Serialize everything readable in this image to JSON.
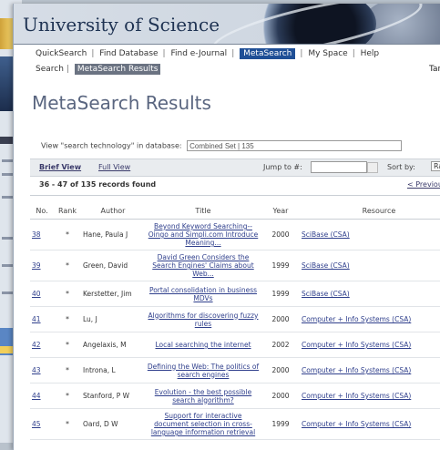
{
  "banner": {
    "title": "University of Science"
  },
  "nav": {
    "items": [
      {
        "label": "QuickSearch"
      },
      {
        "label": "Find Database"
      },
      {
        "label": "Find e-Journal"
      },
      {
        "label": "MetaSearch"
      },
      {
        "label": "My Space"
      },
      {
        "label": "Help"
      }
    ],
    "active_index": 3
  },
  "subnav": {
    "search": "Search",
    "results": "MetaSearch Results",
    "right_tab": "Tar"
  },
  "page_title": "MetaSearch Results",
  "query": {
    "prefix": "View \"search technology\" in database:",
    "database_value": "Combined Set | 135"
  },
  "view": {
    "brief": "Brief View",
    "full": "Full View",
    "jump_label": "Jump to #:",
    "jump_value": "",
    "sort_label": "Sort by:",
    "sort_value": "Ra"
  },
  "count": "36 - 47 of 135 records found",
  "prev": "< Previous",
  "columns": [
    "No.",
    "Rank",
    "Author",
    "Title",
    "Year",
    "Resource"
  ],
  "rows": [
    {
      "no": "38",
      "rank": "*",
      "author": "Hane, Paula J",
      "title": "Beyond Keyword Searching-- Oingo and Simpli.com Introduce Meaning...",
      "year": "2000",
      "resource": "SciBase (CSA)"
    },
    {
      "no": "39",
      "rank": "*",
      "author": "Green, David",
      "title": "David Green Considers the Search Engines' Claims about Web...",
      "year": "1999",
      "resource": "SciBase (CSA)"
    },
    {
      "no": "40",
      "rank": "*",
      "author": "Kerstetter, Jim",
      "title": "Portal consolidation in business MDVs",
      "year": "1999",
      "resource": "SciBase (CSA)"
    },
    {
      "no": "41",
      "rank": "*",
      "author": "Lu, J",
      "title": "Algorithms for discovering fuzzy rules",
      "year": "2000",
      "resource": "Computer + Info Systems (CSA)"
    },
    {
      "no": "42",
      "rank": "*",
      "author": "Angelaxis, M",
      "title": "Local searching the internet",
      "year": "2002",
      "resource": "Computer + Info Systems (CSA)"
    },
    {
      "no": "43",
      "rank": "*",
      "author": "Introna, L",
      "title": "Defining the Web: The politics of search engines",
      "year": "2000",
      "resource": "Computer + Info Systems (CSA)"
    },
    {
      "no": "44",
      "rank": "*",
      "author": "Stanford, P W",
      "title": "Evolution - the best possible search algorithm?",
      "year": "2000",
      "resource": "Computer + Info Systems (CSA)"
    },
    {
      "no": "45",
      "rank": "*",
      "author": "Oard, D W",
      "title": "Support for interactive document selection in cross-language information retrieval",
      "year": "1999",
      "resource": "Computer + Info Systems (CSA)"
    }
  ]
}
